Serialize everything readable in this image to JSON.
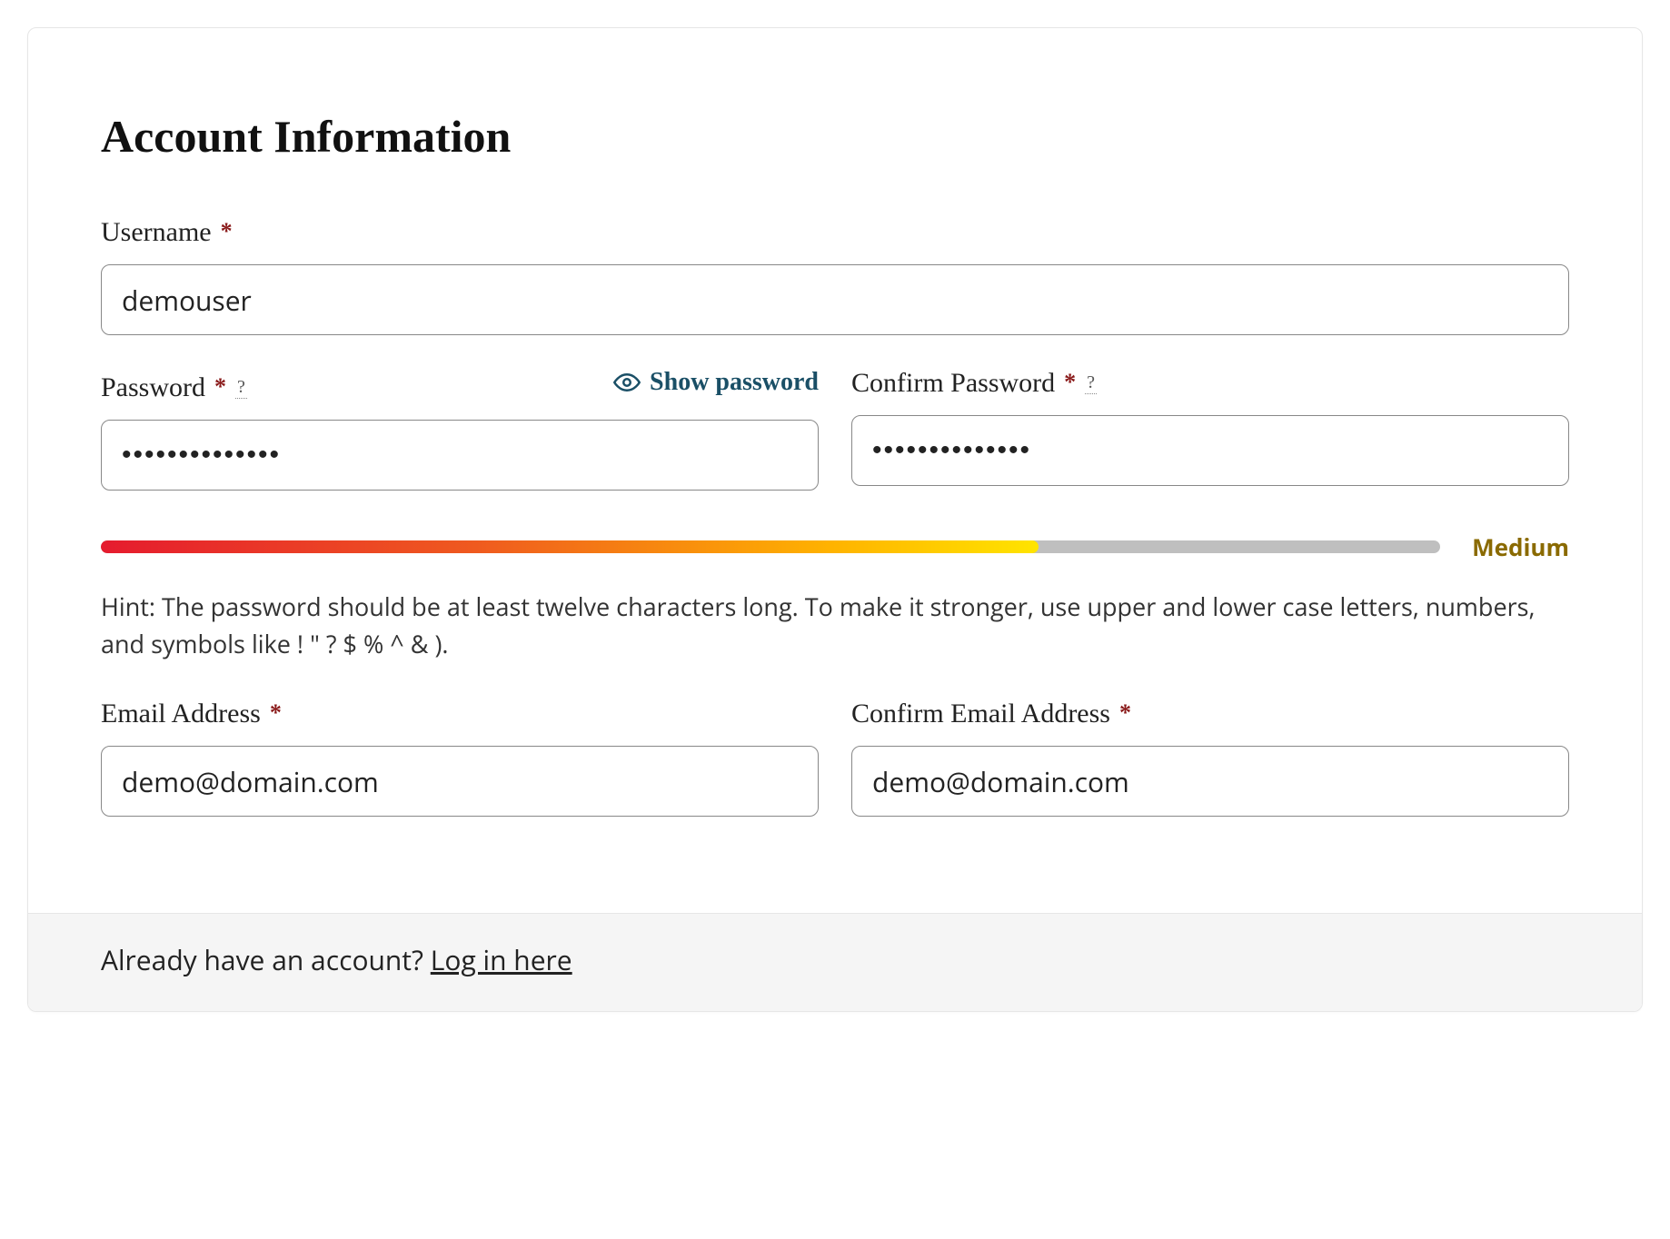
{
  "heading": "Account Information",
  "required_marker": "*",
  "help_marker": "?",
  "fields": {
    "username": {
      "label": "Username",
      "value": "demouser"
    },
    "password": {
      "label": "Password",
      "value": "••••••••••••••",
      "show_password_label": "Show password"
    },
    "confirm_password": {
      "label": "Confirm Password",
      "value": "••••••••••••••"
    },
    "email": {
      "label": "Email Address",
      "value": "demo@domain.com"
    },
    "confirm_email": {
      "label": "Confirm Email Address",
      "value": "demo@domain.com"
    }
  },
  "password_strength": {
    "label": "Medium",
    "percent": 70
  },
  "password_hint": "Hint: The password should be at least twelve characters long. To make it stronger, use upper and lower case letters, numbers, and symbols like ! \" ? $ % ^ & ).",
  "footer": {
    "prompt": "Already have an account? ",
    "link_text": "Log in here"
  }
}
